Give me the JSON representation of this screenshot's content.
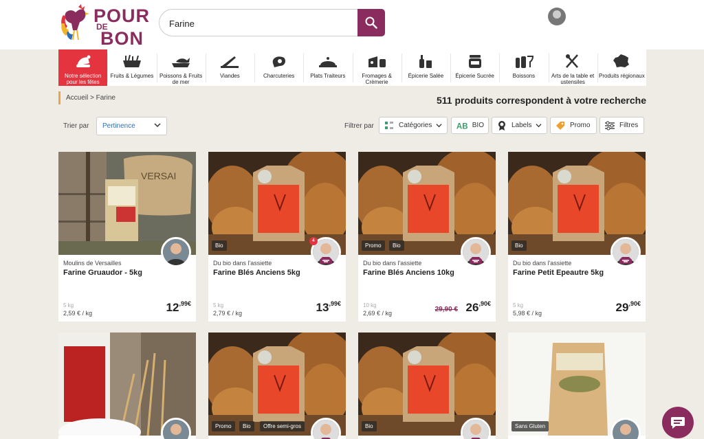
{
  "header": {
    "logo_line1": "POUR",
    "logo_de": "DE",
    "logo_line2": "BON",
    "search_value": "Farine"
  },
  "nav": [
    {
      "label": "Notre sélection pour les fêtes",
      "icon": "gift-hat-icon"
    },
    {
      "label": "Fruits & Légumes",
      "icon": "vegetables-icon"
    },
    {
      "label": "Poissons & Fruits de mer",
      "icon": "fish-icon"
    },
    {
      "label": "Viandes",
      "icon": "knife-icon"
    },
    {
      "label": "Charcuteries",
      "icon": "ham-icon"
    },
    {
      "label": "Plats Traiteurs",
      "icon": "cloche-icon"
    },
    {
      "label": "Fromages & Crèmerie",
      "icon": "cheese-icon"
    },
    {
      "label": "Épicerie Salée",
      "icon": "bottles-icon"
    },
    {
      "label": "Épicerie Sucrée",
      "icon": "jar-icon"
    },
    {
      "label": "Boissons",
      "icon": "wine-glass-icon"
    },
    {
      "label": "Arts de la table et ustensiles",
      "icon": "utensils-icon"
    },
    {
      "label": "Produits régionaux",
      "icon": "france-map-icon"
    }
  ],
  "breadcrumb": "Accueil > Farine",
  "result_title": "511 produits correspondent à votre recherche",
  "sort": {
    "label": "Trier par",
    "value": "Pertinence"
  },
  "filters": {
    "label": "Filtrer par",
    "categories": "Catégories",
    "bio": "BIO",
    "labels": "Labels",
    "promo": "Promo",
    "filtres": "Filtres"
  },
  "products": [
    {
      "brand": "Moulins de Versailles",
      "name": "Farine Gruaudor - 5kg",
      "weight": "5 kg",
      "unit_price": "2,59 € / kg",
      "price_int": "12",
      "price_dec": ",99€",
      "old_price": "",
      "badges": []
    },
    {
      "brand": "Du bio dans l'assiette",
      "name": "Farine Blés Anciens 5kg",
      "weight": "5 kg",
      "unit_price": "2,79 € / kg",
      "price_int": "13",
      "price_dec": ",99€",
      "old_price": "",
      "badges": [
        "Bio"
      ],
      "count": "4"
    },
    {
      "brand": "Du bio dans l'assiette",
      "name": "Farine Blés Anciens 10kg",
      "weight": "10 kg",
      "unit_price": "2,69 € / kg",
      "price_int": "26",
      "price_dec": ",90€",
      "old_price": "29,90 €",
      "badges": [
        "Promo",
        "Bio"
      ]
    },
    {
      "brand": "Du bio dans l'assiette",
      "name": "Farine Petit Epeautre 5kg",
      "weight": "5 kg",
      "unit_price": "5,98 € / kg",
      "price_int": "29",
      "price_dec": ",90€",
      "old_price": "",
      "badges": [
        "Bio"
      ]
    }
  ],
  "row2_badges": [
    [],
    [
      "Promo",
      "Bio",
      "Offre semi-gros"
    ],
    [
      "Bio"
    ],
    [
      "Sans Gluten"
    ]
  ]
}
